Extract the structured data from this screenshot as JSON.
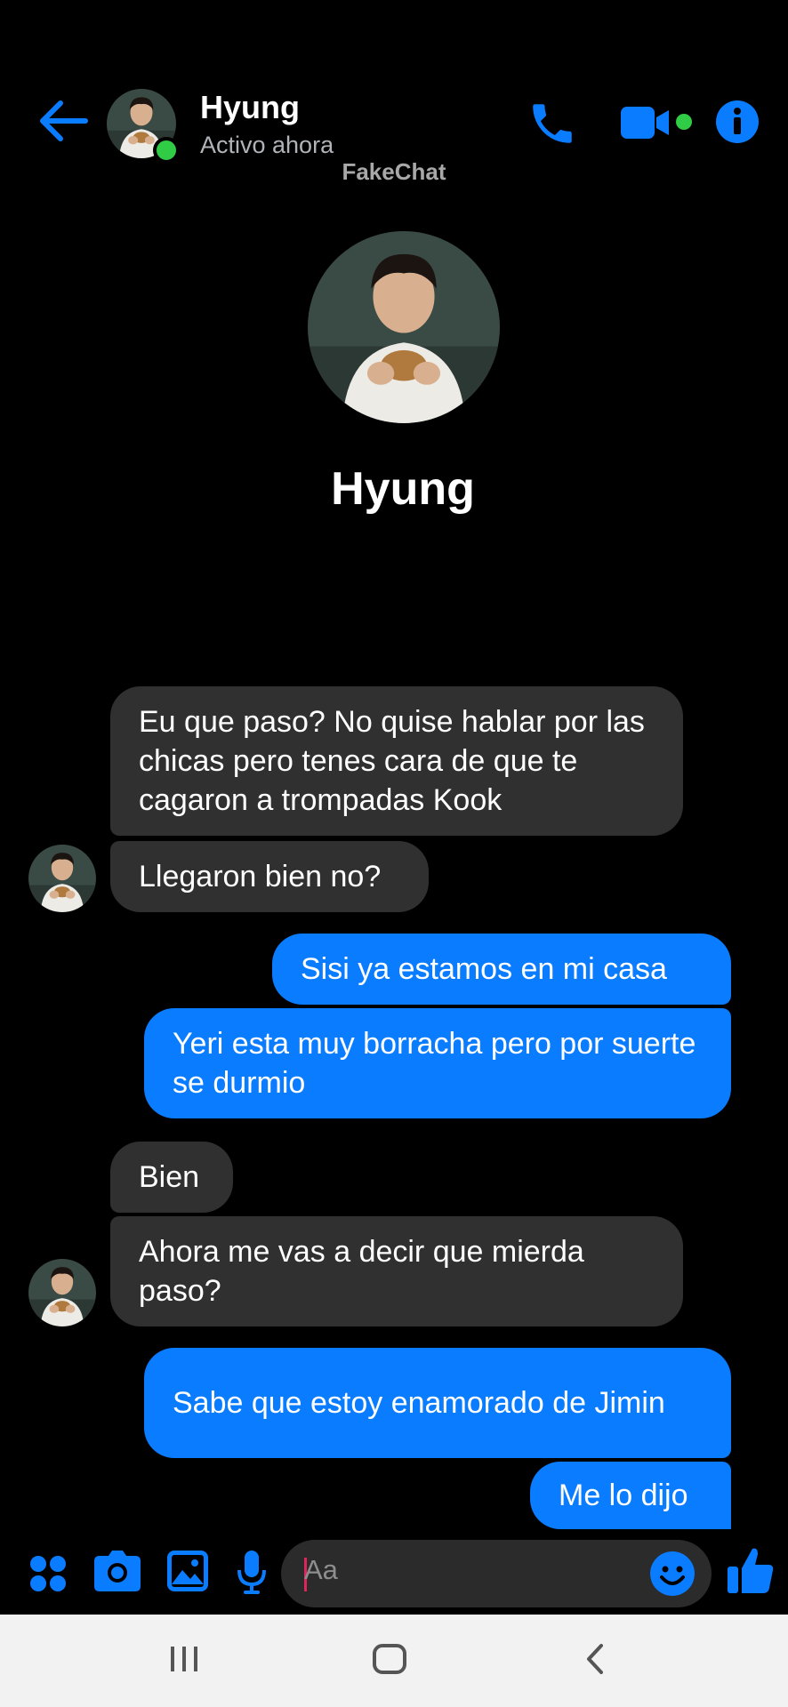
{
  "header": {
    "contact_name": "Hyung",
    "status": "Activo ahora",
    "watermark": "FakeChat"
  },
  "profile": {
    "name": "Hyung"
  },
  "messages": [
    {
      "direction": "incoming",
      "text": "Eu que paso? No quise hablar por las chicas pero tenes cara de que te cagaron a trompadas Kook"
    },
    {
      "direction": "incoming",
      "text": "Llegaron bien no?"
    },
    {
      "direction": "outgoing",
      "text": "Sisi ya estamos en mi casa"
    },
    {
      "direction": "outgoing",
      "text": "Yeri esta muy borracha pero por suerte se durmio"
    },
    {
      "direction": "incoming",
      "text": "Bien"
    },
    {
      "direction": "incoming",
      "text": "Ahora me vas a decir que mierda paso?"
    },
    {
      "direction": "outgoing",
      "text": "Sabe que estoy enamorado de Jimin"
    },
    {
      "direction": "outgoing",
      "text": "Me lo dijo"
    }
  ],
  "composer": {
    "placeholder": "Aa"
  },
  "icons": {
    "header": [
      "back-arrow-icon",
      "phone-icon",
      "video-camera-icon",
      "info-icon"
    ],
    "composer": [
      "apps-grid-icon",
      "camera-icon",
      "image-icon",
      "microphone-icon",
      "emoji-icon",
      "thumbs-up-icon"
    ],
    "navbar": [
      "recents-icon",
      "home-icon",
      "back-icon"
    ]
  },
  "colors": {
    "accent": "#0a7cff",
    "online": "#31cc46",
    "incoming_bubble": "#303030",
    "background": "#000000"
  }
}
